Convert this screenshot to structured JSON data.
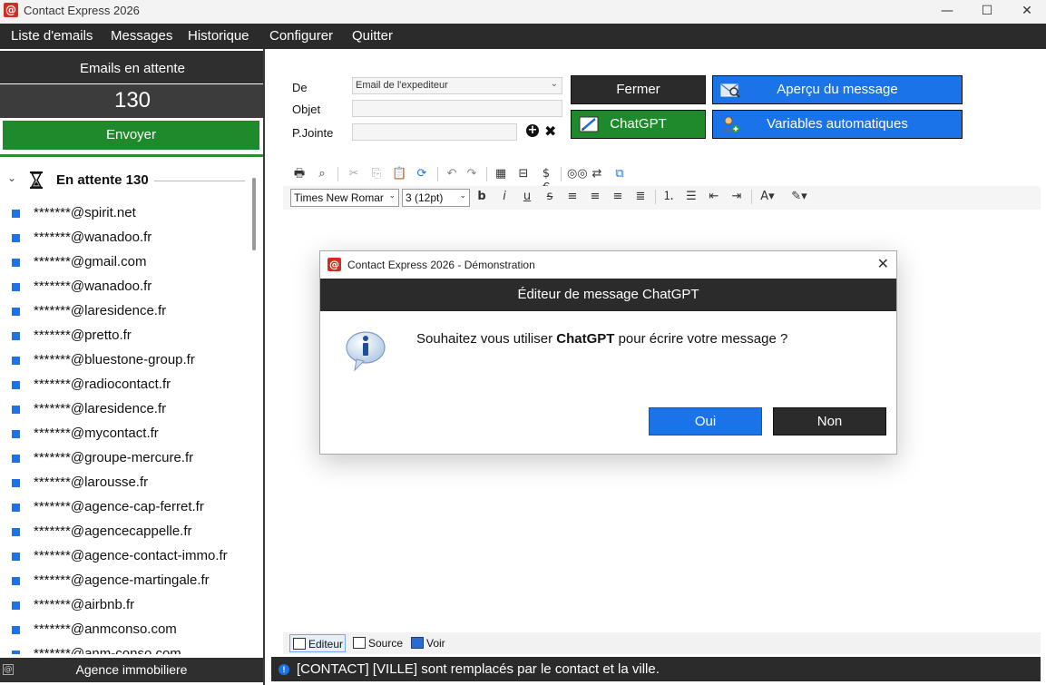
{
  "window": {
    "title": "Contact Express 2026",
    "logo": "@",
    "minimize": "—",
    "maximize": "☐",
    "close": "✕"
  },
  "menu": {
    "items": [
      "Liste d'emails",
      "Messages",
      "Historique",
      "Configurer",
      "Quitter"
    ]
  },
  "sidebar": {
    "header": "Emails en attente",
    "count": "130",
    "send_label": "Envoyer",
    "tree_label": "En attente 130",
    "emails": [
      "*******@spirit.net",
      "*******@wanadoo.fr",
      "*******@gmail.com",
      "*******@wanadoo.fr",
      "*******@laresidence.fr",
      "*******@pretto.fr",
      "*******@bluestone-group.fr",
      "*******@radiocontact.fr",
      "*******@laresidence.fr",
      "*******@mycontact.fr",
      "*******@groupe-mercure.fr",
      "*******@larousse.fr",
      "*******@agence-cap-ferret.fr",
      "*******@agencecappelle.fr",
      "*******@agence-contact-immo.fr",
      "*******@agence-martingale.fr",
      "*******@airbnb.fr",
      "*******@anmconso.com",
      "*******@anm-conso.com"
    ],
    "footer": "Agence immobiliere"
  },
  "form": {
    "from_label": "De",
    "from_value": "Email de l'expediteur",
    "subject_label": "Objet",
    "attach_label": "P.Jointe"
  },
  "buttons": {
    "close": "Fermer",
    "preview": "Aperçu du message",
    "chatgpt": "ChatGPT",
    "variables": "Variables automatiques"
  },
  "toolbar": {
    "font": "Times New Romar",
    "size": "3 (12pt)"
  },
  "editor_tabs": {
    "editor": "Editeur",
    "source": "Source",
    "view": "Voir"
  },
  "status": {
    "text": "[CONTACT] [VILLE] sont remplacés par le contact et la ville."
  },
  "dialog": {
    "title": "Contact Express 2026 - Démonstration",
    "header": "Éditeur de message ChatGPT",
    "message_before": "Souhaitez vous utiliser ",
    "message_bold": "ChatGPT",
    "message_after": " pour écrire votre message ?",
    "yes": "Oui",
    "no": "Non"
  },
  "colors": {
    "accent_blue": "#1a73e8",
    "accent_green": "#1f8a2c",
    "dark": "#2b2b2b",
    "brand_red": "#d62b1f"
  }
}
